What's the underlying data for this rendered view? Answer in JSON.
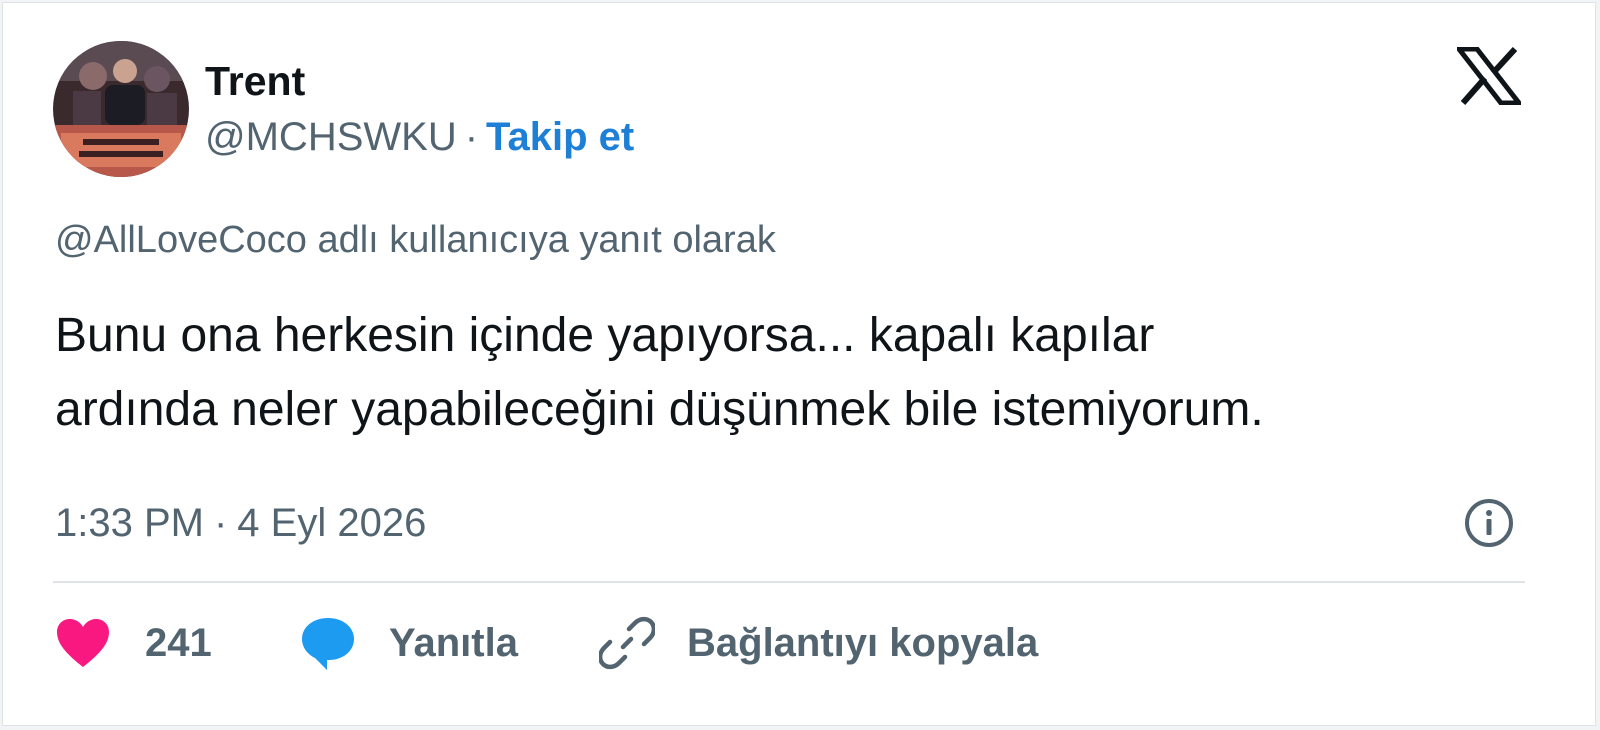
{
  "author": {
    "name": "Trent",
    "handle": "@MCHSWKU",
    "separator": "·",
    "follow_label": "Takip et"
  },
  "reply_context": "@AllLoveCoco adlı kullanıcıya yanıt olarak",
  "tweet": {
    "lines": [
      "Bunu ona herkesin içinde yapıyorsa... kapalı kapılar",
      "ardında neler yapabileceğini düşünmek bile istemiyorum."
    ]
  },
  "meta": {
    "time": "1:33 PM",
    "separator": "·",
    "date": "4 Eyl 2026"
  },
  "actions": {
    "like_count": "241",
    "reply_label": "Yanıtla",
    "copy_link_label": "Bağlantıyı kopyala"
  },
  "icons": {
    "brand": "x-logo-icon",
    "info": "info-icon",
    "like": "heart-icon",
    "reply": "speech-bubble-icon",
    "copy": "link-icon"
  },
  "colors": {
    "accent": "#1d7fd6",
    "heart": "#f91880",
    "reply_bubble": "#1d9bf0",
    "secondary_text": "#536471",
    "primary_text": "#0f1419"
  }
}
